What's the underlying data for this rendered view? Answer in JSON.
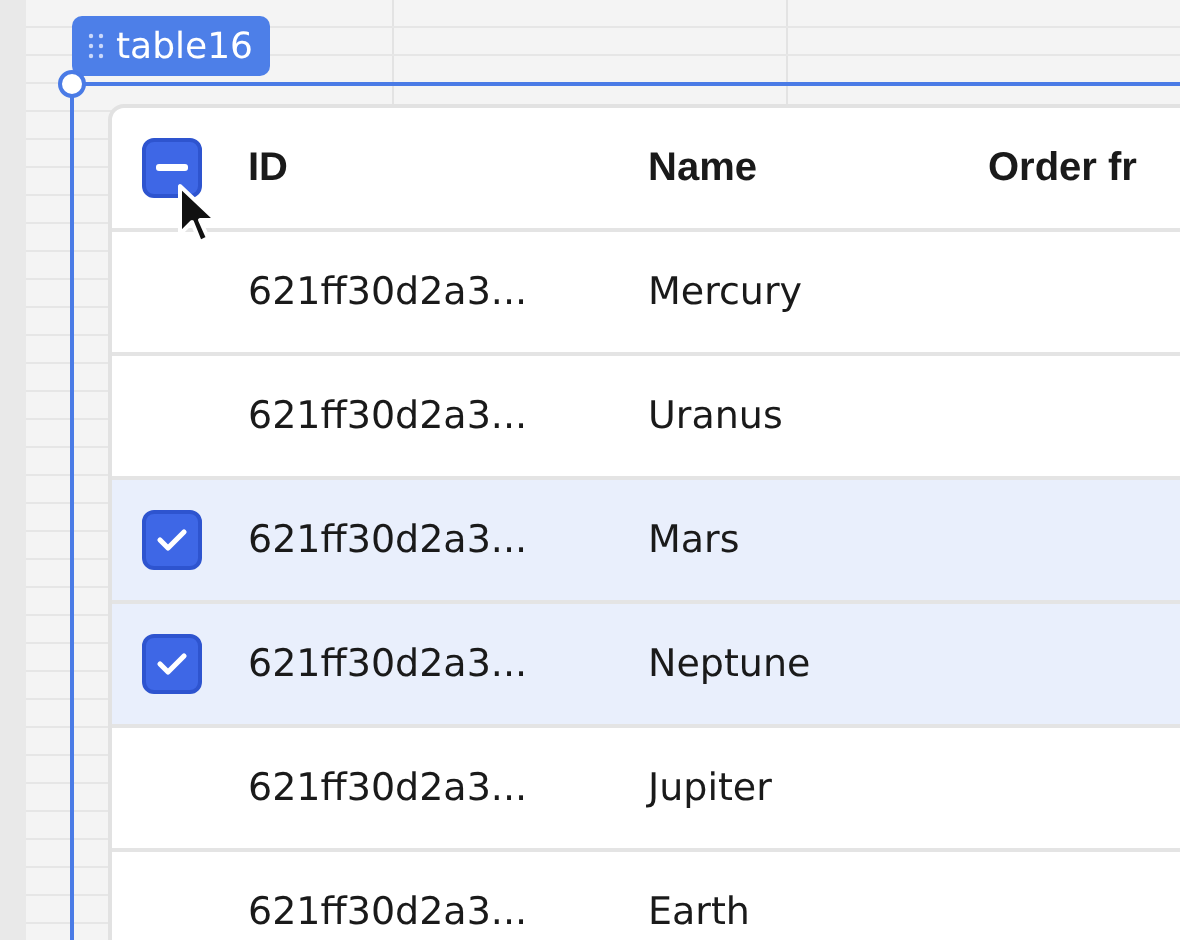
{
  "component_label": "table16",
  "table": {
    "select_all": {
      "indeterminate": true
    },
    "columns": [
      "ID",
      "Name",
      "Order fr"
    ],
    "rows": [
      {
        "selected": false,
        "cells": [
          "621ff30d2a3...",
          "Mercury"
        ]
      },
      {
        "selected": false,
        "cells": [
          "621ff30d2a3...",
          "Uranus"
        ]
      },
      {
        "selected": true,
        "cells": [
          "621ff30d2a3...",
          "Mars"
        ]
      },
      {
        "selected": true,
        "cells": [
          "621ff30d2a3...",
          "Neptune"
        ]
      },
      {
        "selected": false,
        "cells": [
          "621ff30d2a3...",
          "Jupiter"
        ]
      },
      {
        "selected": false,
        "cells": [
          "621ff30d2a3...",
          "Earth"
        ]
      }
    ]
  }
}
